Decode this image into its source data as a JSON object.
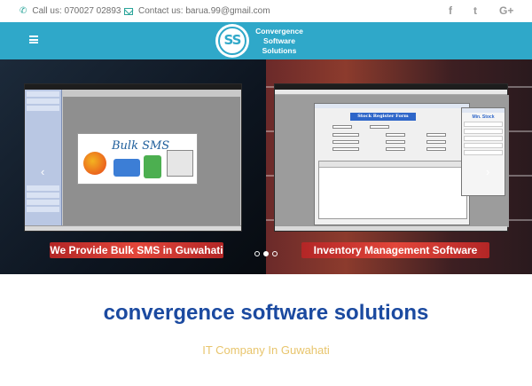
{
  "topbar": {
    "phone_label": "Call us: 070027 02893",
    "email_label": "Contact us: barua.99@gmail.com",
    "social": [
      "f",
      "t",
      "G+"
    ]
  },
  "navbar": {
    "logo_mark": "SS",
    "logo_text_line1": "Convergence",
    "logo_text_line2": "Software",
    "logo_text_line3": "Solutions"
  },
  "slider": {
    "left_caption": "We Provide Bulk SMS in Guwahati",
    "right_caption": "Inventory Management Software",
    "bulk_sms_title": "Bulk SMS",
    "stock_form_title": "Stock Register Form",
    "min_stock_title": "Min. Stock",
    "prev_arrow": "‹",
    "next_arrow": "›",
    "active_slide": 2,
    "slide_count": 3
  },
  "main": {
    "headline": "convergence software solutions",
    "tagline": "IT Company In Guwahati"
  }
}
